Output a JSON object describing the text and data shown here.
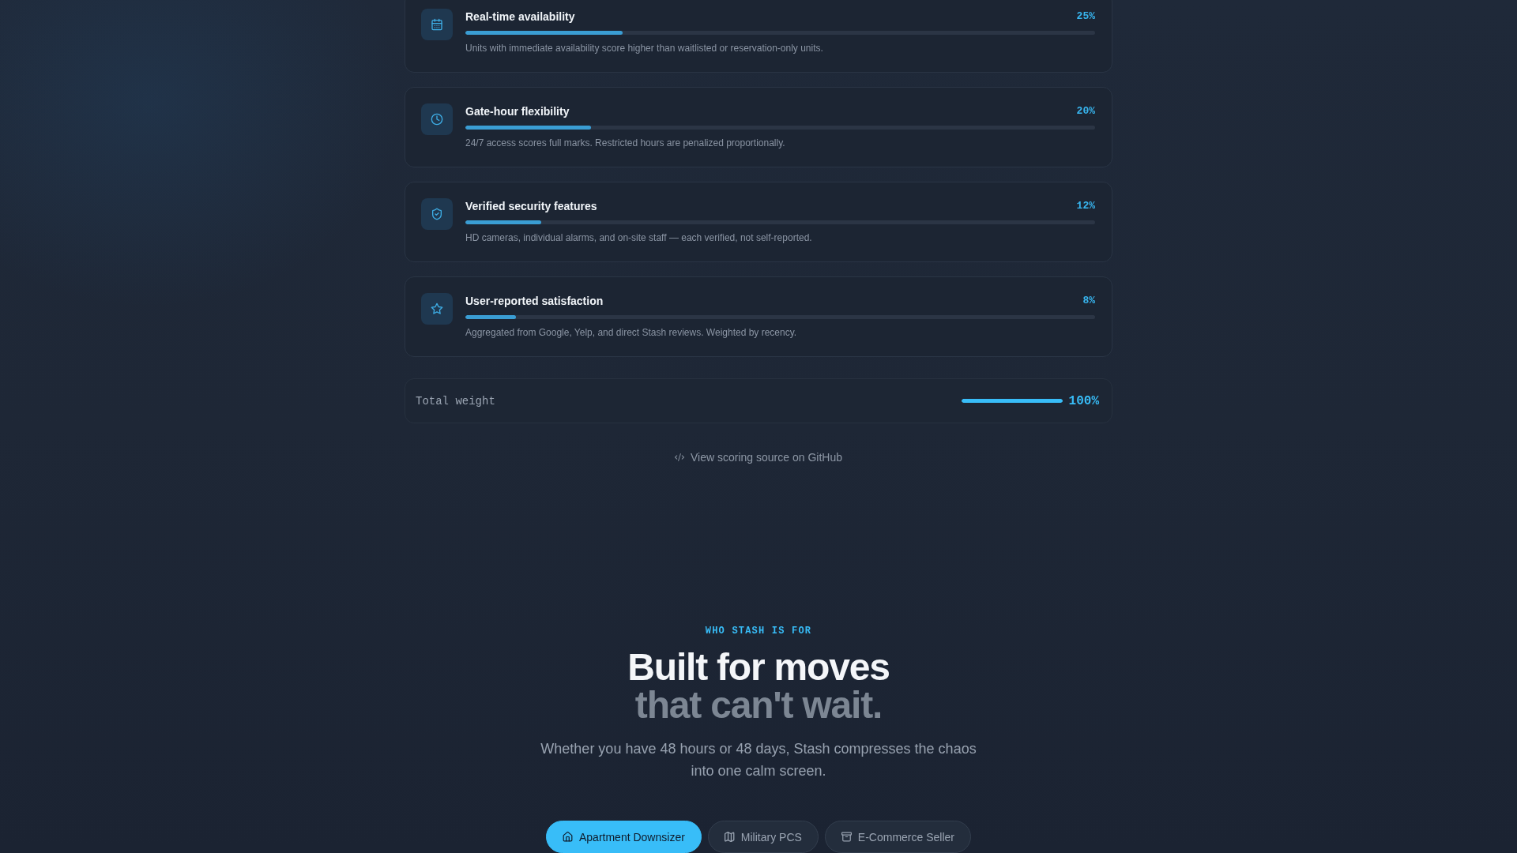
{
  "criteria": [
    {
      "title": "Real-time availability",
      "weight": "25%",
      "level": 0.25,
      "description": "Units with immediate availability score higher than waitlisted or reservation-only units."
    },
    {
      "title": "Gate-hour flexibility",
      "weight": "20%",
      "level": 0.2,
      "description": "24/7 access scores full marks. Restricted hours are penalized proportionally."
    },
    {
      "title": "Verified security features",
      "weight": "12%",
      "level": 0.12,
      "description": "HD cameras, individual alarms, and on-site staff — each verified, not self-reported."
    },
    {
      "title": "User-reported satisfaction",
      "weight": "8%",
      "level": 0.08,
      "description": "Aggregated from Google, Yelp, and direct Stash reviews. Weighted by recency."
    }
  ],
  "total": {
    "label": "Total weight",
    "value": "100%",
    "level": 1
  },
  "source_link": {
    "label": "View scoring source on GitHub"
  },
  "audience": {
    "eyebrow": "WHO STASH IS FOR",
    "title": "Built for moves",
    "title_muted": "that can't wait.",
    "subtitle": "Whether you have 48 hours or 48 days, Stash compresses the chaos into one calm screen.",
    "personas": [
      {
        "label": "Apartment Downsizer",
        "selected": true
      },
      {
        "label": "Military PCS",
        "selected": false
      },
      {
        "label": "E-Commerce Seller",
        "selected": false
      }
    ]
  }
}
